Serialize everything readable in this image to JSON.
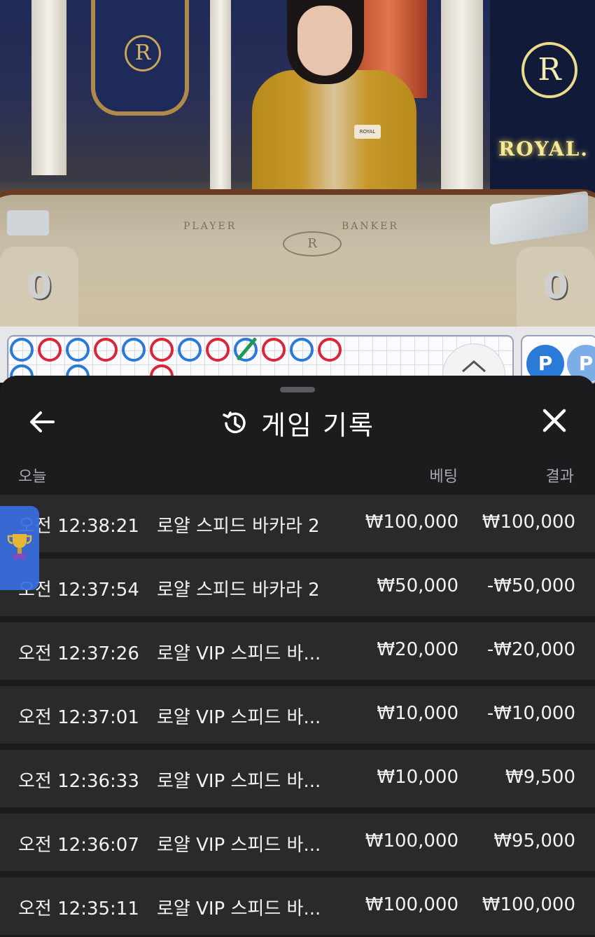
{
  "video": {
    "player_label": "PLAYER",
    "banker_label": "BANKER",
    "royal_text": "ROYAL.",
    "player_score": "0",
    "banker_score": "0"
  },
  "roadmap": {
    "player_chip": "P",
    "results_row1": [
      "P",
      "B",
      "P",
      "B",
      "P",
      "B",
      "P",
      "B",
      "T",
      "B",
      "P",
      "B"
    ]
  },
  "history": {
    "title": "게임 기록",
    "columns": {
      "today": "오늘",
      "bet": "베팅",
      "result": "결과"
    },
    "rows": [
      {
        "time": "오전 12:38:21",
        "game": "로얄 스피드 바카라 2",
        "bet": "₩100,000",
        "result": "₩100,000"
      },
      {
        "time": "오전 12:37:54",
        "game": "로얄 스피드 바카라 2",
        "bet": "₩50,000",
        "result": "-₩50,000"
      },
      {
        "time": "오전 12:37:26",
        "game": "로얄 VIP 스피드 바...",
        "bet": "₩20,000",
        "result": "-₩20,000"
      },
      {
        "time": "오전 12:37:01",
        "game": "로얄 VIP 스피드 바...",
        "bet": "₩10,000",
        "result": "-₩10,000"
      },
      {
        "time": "오전 12:36:33",
        "game": "로얄 VIP 스피드 바...",
        "bet": "₩10,000",
        "result": "₩9,500"
      },
      {
        "time": "오전 12:36:07",
        "game": "로얄 VIP 스피드 바...",
        "bet": "₩100,000",
        "result": "₩95,000"
      },
      {
        "time": "오전 12:35:11",
        "game": "로얄 VIP 스피드 바...",
        "bet": "₩100,000",
        "result": "₩100,000"
      }
    ]
  },
  "colors": {
    "sheet_bg": "#1c1c1f",
    "row_bg": "#2a2a2d",
    "player_blue": "#2a7bd8",
    "banker_red": "#d8263a",
    "tie_green": "#1f9a4a"
  },
  "icons": [
    "back-arrow-icon",
    "history-clock-icon",
    "close-icon",
    "chevron-up-icon",
    "trophy-icon"
  ]
}
